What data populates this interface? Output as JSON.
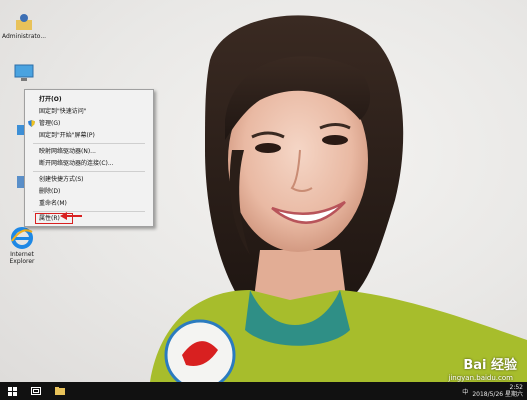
{
  "desktop_icons": [
    {
      "name": "user-folder",
      "label": "Administrato..."
    },
    {
      "name": "this-pc",
      "label": ""
    },
    {
      "name": "network",
      "label": ""
    },
    {
      "name": "control-panel",
      "label": ""
    },
    {
      "name": "recycle-bin",
      "label": ""
    },
    {
      "name": "internet-explorer",
      "label": "Internet Explorer"
    }
  ],
  "context_menu": {
    "items": [
      {
        "label": "打开(O)",
        "bold": true
      },
      {
        "label": "固定到\"快速访问\""
      },
      {
        "label": "管理(G)",
        "icon": "shield-icon"
      },
      {
        "label": "固定到\"开始\"屏幕(P)"
      },
      {
        "label": "映射网络驱动器(N)..."
      },
      {
        "label": "断开网络驱动器的连接(C)..."
      },
      {
        "label": "创建快捷方式(S)"
      },
      {
        "label": "删除(D)"
      },
      {
        "label": "重命名(M)"
      },
      {
        "label": "属性(R)",
        "highlighted": true
      }
    ]
  },
  "taskbar": {
    "start_icon": "windows-logo-icon",
    "task_view_icon": "task-view-icon",
    "explorer_icon": "folder-icon",
    "tray": {
      "language": "中",
      "time": "2:52",
      "date": "2018/5/26 星期六"
    }
  },
  "watermark": {
    "brand": "Bai 经验",
    "url": "jingyan.baidu.com"
  },
  "colors": {
    "taskbar": "#111111",
    "menu_bg": "#f2f2f2",
    "highlight": "#d82020"
  }
}
